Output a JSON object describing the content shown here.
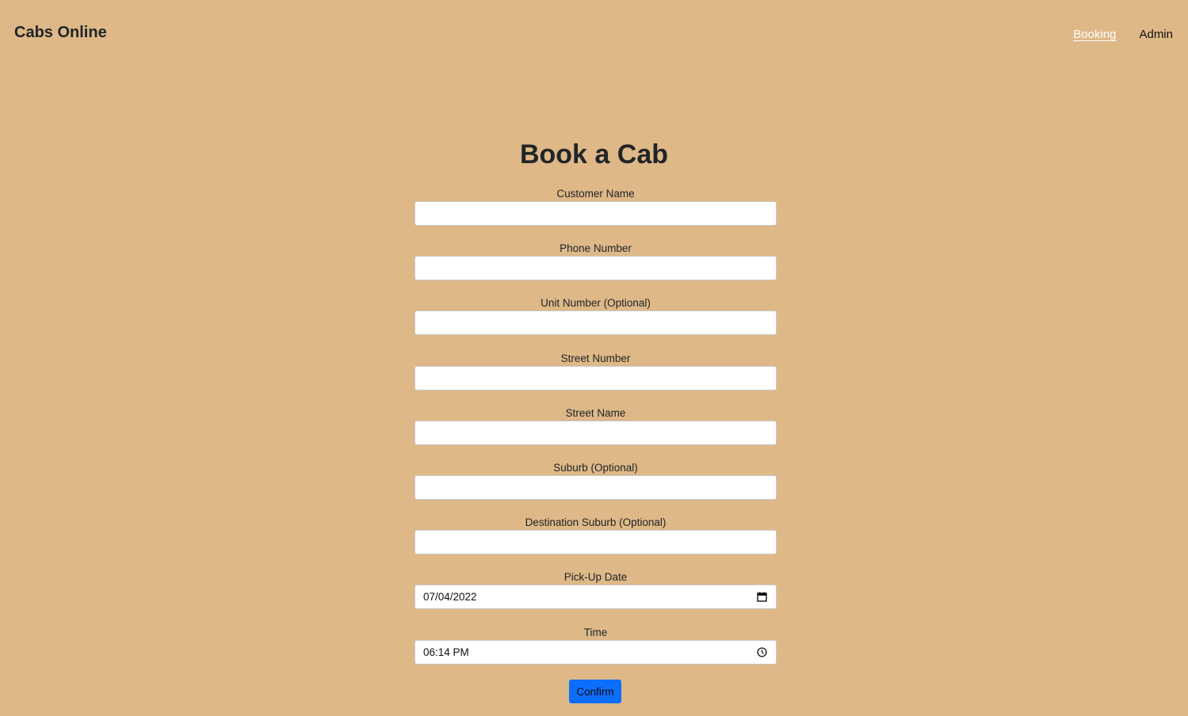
{
  "header": {
    "brand": "Cabs Online",
    "nav": [
      {
        "label": "Booking",
        "active": true
      },
      {
        "label": "Admin",
        "active": false
      }
    ]
  },
  "page": {
    "title": "Book a Cab"
  },
  "form": {
    "customer_name": {
      "label": "Customer Name",
      "value": ""
    },
    "phone_number": {
      "label": "Phone Number",
      "value": ""
    },
    "unit_number": {
      "label": "Unit Number (Optional)",
      "value": ""
    },
    "street_number": {
      "label": "Street Number",
      "value": ""
    },
    "street_name": {
      "label": "Street Name",
      "value": ""
    },
    "suburb": {
      "label": "Suburb (Optional)",
      "value": ""
    },
    "destination_suburb": {
      "label": "Destination Suburb (Optional)",
      "value": ""
    },
    "pickup_date": {
      "label": "Pick-Up Date",
      "value": "07/04/2022",
      "icon": "calendar-icon"
    },
    "time": {
      "label": "Time",
      "value": "06:14 PM",
      "icon": "clock-icon"
    },
    "confirm_label": "Confirm"
  },
  "colors": {
    "background": "#deb887",
    "button": "#0d6efd",
    "active_nav": "#ffffff"
  }
}
